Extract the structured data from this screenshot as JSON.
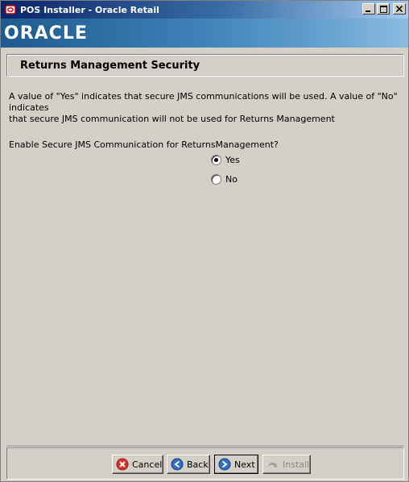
{
  "window": {
    "title": "POS Installer - Oracle Retail",
    "icon": "java-app-icon",
    "controls": [
      "minimize-icon",
      "maximize-icon",
      "close-icon"
    ]
  },
  "banner": {
    "logo_text": "ORACLE"
  },
  "page": {
    "section_title": "Returns Management Security",
    "description_line1": "A value of \"Yes\" indicates that secure JMS communications will be used.  A value of \"No\" indicates",
    "description_line2": "that secure JMS communication will not be used for Returns Management",
    "question": "Enable Secure JMS Communication for ReturnsManagement?",
    "options": [
      {
        "label": "Yes",
        "selected": true
      },
      {
        "label": "No",
        "selected": false
      }
    ]
  },
  "buttons": {
    "cancel": "Cancel",
    "back": "Back",
    "next": "Next",
    "install": "Install"
  },
  "colors": {
    "background": "#d4d0c8",
    "titlebar_start": "#0a246a",
    "banner": "#3a7eb5",
    "cancel_icon": "#d9302a",
    "nav_icon": "#2f6fc4"
  }
}
